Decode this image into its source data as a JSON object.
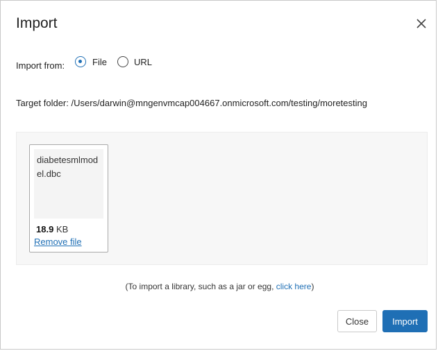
{
  "dialog": {
    "title": "Import",
    "close_icon": "close-icon"
  },
  "import_from": {
    "label": "Import from:",
    "options": [
      {
        "label": "File",
        "selected": true
      },
      {
        "label": "URL",
        "selected": false
      }
    ]
  },
  "target_folder": "Target folder: /Users/darwin@mngenvmcap004667.onmicrosoft.com/testing/moretesting",
  "file": {
    "name": "diabetesmlmodel.dbc",
    "size_value": "18.9",
    "size_unit": "KB",
    "remove_label": "Remove file"
  },
  "library_note": {
    "prefix": "(To import a library, such as a jar or egg, ",
    "link": "click here",
    "suffix": ")"
  },
  "footer": {
    "close_label": "Close",
    "import_label": "Import"
  },
  "colors": {
    "accent": "#1f6fb5"
  }
}
